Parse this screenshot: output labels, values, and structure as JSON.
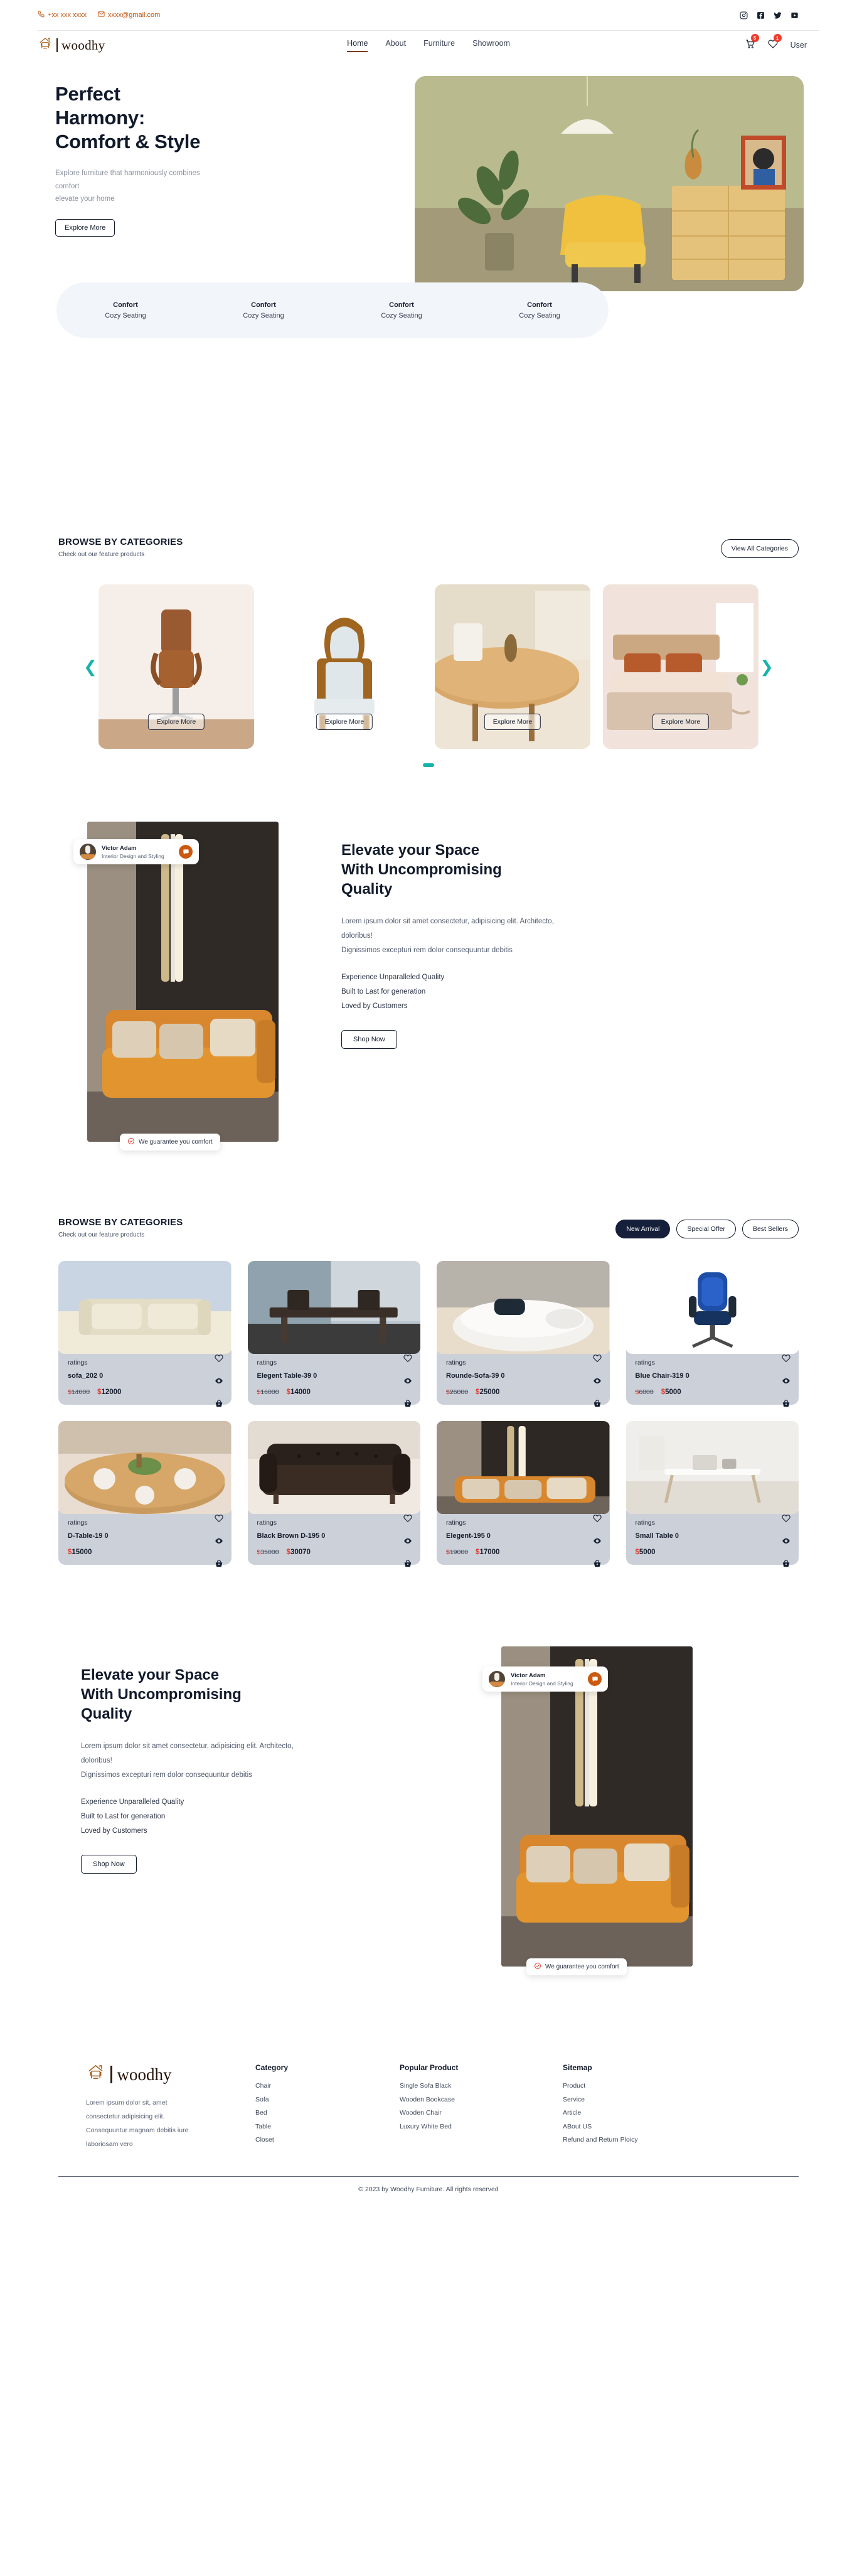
{
  "topbar": {
    "phone": "+xx xxx xxxx",
    "email": "xxxx@gmail.com",
    "socials": [
      "instagram-icon",
      "facebook-icon",
      "twitter-icon",
      "youtube-icon"
    ]
  },
  "nav": {
    "brand": "woodhy",
    "menu": [
      {
        "label": "Home",
        "active": true
      },
      {
        "label": "About",
        "active": false
      },
      {
        "label": "Furniture",
        "active": false
      },
      {
        "label": "Showroom",
        "active": false
      }
    ],
    "cart_count": "5",
    "wishlist_count": "1",
    "user_label": "User"
  },
  "hero": {
    "title_line1": "Perfect",
    "title_line2": "Harmony:",
    "title_line3": "Comfort & Style",
    "sub_line1": "Explore furniture that harmoniously combines",
    "sub_line2": "comfort",
    "sub_line3": "elevate your home",
    "cta": "Explore More",
    "features": [
      {
        "title": "Confort",
        "subtitle": "Cozy Seating"
      },
      {
        "title": "Confort",
        "subtitle": "Cozy Seating"
      },
      {
        "title": "Confort",
        "subtitle": "Cozy Seating"
      },
      {
        "title": "Confort",
        "subtitle": "Cozy Seating"
      }
    ]
  },
  "categories_section": {
    "title": "BROWSE BY CATEGORIES",
    "subtitle": "Check out our feature products",
    "view_all": "View All Categories",
    "prev_icon": "chevron-left-icon",
    "next_icon": "chevron-right-icon",
    "cards": [
      {
        "cta": "Explore More",
        "alt": "brown-office-chair"
      },
      {
        "cta": "Explore More",
        "alt": "white-vintage-armchair"
      },
      {
        "cta": "Explore More",
        "alt": "wooden-round-table"
      },
      {
        "cta": "Explore More",
        "alt": "bedroom-bed"
      }
    ]
  },
  "showcase_top": {
    "designer_name": "Victor Adam",
    "designer_role": "Interior Design and Styling",
    "chat_icon": "chat-bubble-icon",
    "guarantee": "We guarantee you comfort",
    "guarantee_icon": "check-circle-icon",
    "title_line1": "Elevate your Space",
    "title_line2": "With Uncompromising",
    "title_line3": "Quality",
    "paragraph_line1": "Lorem ipsum dolor sit amet consectetur, adipisicing elit. Architecto,",
    "paragraph_line2": "doloribus!",
    "paragraph_line3": "Dignissimos excepturi rem dolor consequuntur debitis",
    "bullets": [
      "Experience Unparalleled Quality",
      "Built to Last for generation",
      "Loved by Customers"
    ],
    "cta": "Shop Now"
  },
  "products_section": {
    "title": "BROWSE BY CATEGORIES",
    "subtitle": "Check out our feature products",
    "tabs": [
      {
        "label": "New Arrival",
        "active": true
      },
      {
        "label": "Special Offer",
        "active": false
      },
      {
        "label": "Best Sellers",
        "active": false
      }
    ],
    "items": [
      {
        "ratings": "ratings",
        "name": "sofa_202 0",
        "old_price": "14000",
        "new_price": "12000",
        "currency": "$",
        "alt": "cream-sofa"
      },
      {
        "ratings": "ratings",
        "name": "Elegent Table-39 0",
        "old_price": "16000",
        "new_price": "14000",
        "currency": "$",
        "alt": "dining-table"
      },
      {
        "ratings": "ratings",
        "name": "Rounde-Sofa-39 0",
        "old_price": "26000",
        "new_price": "25000",
        "currency": "$",
        "alt": "round-white-sofa"
      },
      {
        "ratings": "ratings",
        "name": "Blue Chair-319 0",
        "old_price": "6000",
        "new_price": "5000",
        "currency": "$",
        "alt": "blue-office-chair"
      },
      {
        "ratings": "ratings",
        "name": "D-Table-19 0",
        "old_price": "",
        "new_price": "15000",
        "currency": "$",
        "alt": "wooden-dining-set"
      },
      {
        "ratings": "ratings",
        "name": "Black Brown D-195 0",
        "old_price": "35000",
        "new_price": "30070",
        "currency": "$",
        "alt": "black-chesterfield-sofa"
      },
      {
        "ratings": "ratings",
        "name": "Elegent-195 0",
        "old_price": "19000",
        "new_price": "17000",
        "currency": "$",
        "alt": "orange-sofa-lamp"
      },
      {
        "ratings": "ratings",
        "name": "Small Table 0",
        "old_price": "",
        "new_price": "5000",
        "currency": "$",
        "alt": "white-small-table"
      }
    ],
    "card_icons": {
      "wishlist": "heart-icon",
      "quickview": "eye-icon",
      "cart": "basket-icon"
    }
  },
  "showcase_bottom": {
    "title_line1": "Elevate your Space",
    "title_line2": "With Uncompromising",
    "title_line3": "Quality",
    "paragraph_line1": "Lorem ipsum dolor sit amet consectetur, adipisicing elit. Architecto,",
    "paragraph_line2": "doloribus!",
    "paragraph_line3": "Dignissimos excepturi rem dolor consequuntur debitis",
    "bullets": [
      "Experience Unparalleled Quality",
      "Built to Last for generation",
      "Loved by Customers"
    ],
    "cta": "Shop Now",
    "designer_name": "Victor Adam",
    "designer_role": "Interior Design and Styling",
    "guarantee": "We guarantee you comfort"
  },
  "footer": {
    "brand": "woodhy",
    "description": "Lorem ipsum dolor sit, amet consectetur adipisicing elit. Consequuntur magnam debitis iure laboriosam vero",
    "columns": [
      {
        "heading": "Category",
        "links": [
          "Chair",
          "Sofa",
          "Bed",
          "Table",
          "Closet"
        ]
      },
      {
        "heading": "Popular Product",
        "links": [
          "Single Sofa Black",
          "Wooden Bookcase",
          "Wooden Chair",
          "Luxury White Bed"
        ]
      },
      {
        "heading": "Sitemap",
        "links": [
          "Product",
          "Service",
          "Article",
          "ABout US",
          "Refund and Return Ploicy"
        ]
      }
    ],
    "copyright": "© 2023 by Woodhy Furniture. All rights reserved"
  },
  "colors": {
    "accent_orange": "#c1540f",
    "badge_red": "#ef3b2e",
    "teal": "#18b3ab",
    "dark": "#16203a",
    "price_red": "#e0392b",
    "card_gray": "#ccd0d9"
  }
}
